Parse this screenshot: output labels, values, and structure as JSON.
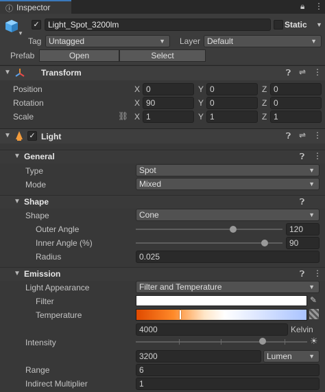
{
  "tab": {
    "title": "Inspector"
  },
  "object": {
    "name": "Light_Spot_3200lm",
    "static_label": "Static",
    "tag_label": "Tag",
    "tag_value": "Untagged",
    "layer_label": "Layer",
    "layer_value": "Default",
    "prefab_label": "Prefab",
    "open_label": "Open",
    "select_label": "Select"
  },
  "transform": {
    "title": "Transform",
    "position_label": "Position",
    "rotation_label": "Rotation",
    "scale_label": "Scale",
    "axes": [
      "X",
      "Y",
      "Z"
    ],
    "position": [
      "0",
      "0",
      "0"
    ],
    "rotation": [
      "90",
      "0",
      "0"
    ],
    "scale": [
      "1",
      "1",
      "1"
    ]
  },
  "light": {
    "title": "Light",
    "general": {
      "title": "General",
      "type_label": "Type",
      "type_value": "Spot",
      "mode_label": "Mode",
      "mode_value": "Mixed"
    },
    "shape": {
      "title": "Shape",
      "shape_label": "Shape",
      "shape_value": "Cone",
      "outer_label": "Outer Angle",
      "outer_value": "120",
      "inner_label": "Inner Angle (%)",
      "inner_value": "90",
      "radius_label": "Radius",
      "radius_value": "0.025"
    },
    "emission": {
      "title": "Emission",
      "appearance_label": "Light Appearance",
      "appearance_value": "Filter and Temperature",
      "filter_label": "Filter",
      "temperature_label": "Temperature",
      "temperature_value": "4000",
      "kelvin_label": "Kelvin",
      "intensity_label": "Intensity",
      "intensity_value": "3200",
      "intensity_unit": "Lumen",
      "range_label": "Range",
      "range_value": "6",
      "indirect_label": "Indirect Multiplier",
      "indirect_value": "1"
    }
  },
  "colors": {
    "accent": "#f39c3c",
    "bg": "#383838",
    "field": "#2a2a2a"
  }
}
